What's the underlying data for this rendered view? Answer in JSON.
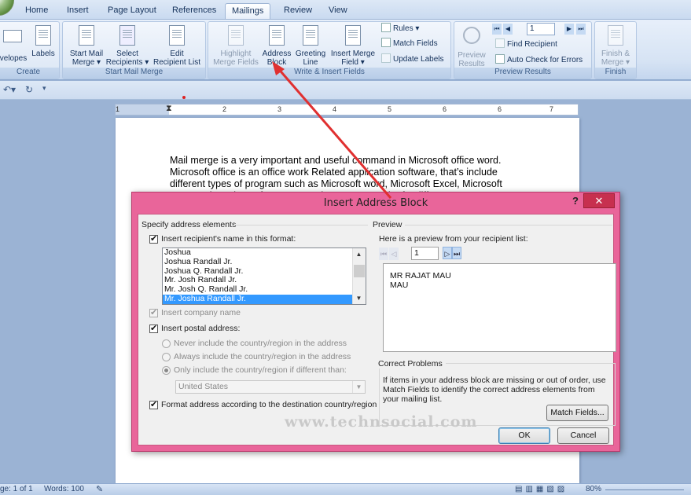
{
  "ribbon_tabs": [
    "Home",
    "Insert",
    "Page Layout",
    "References",
    "Mailings",
    "Review",
    "View"
  ],
  "active_tab": "Mailings",
  "ribbon": {
    "create": {
      "envelopes": "velopes",
      "labels": "Labels",
      "group_label": "Create"
    },
    "start_mail_merge": {
      "start": [
        "Start Mail",
        "Merge ▾"
      ],
      "select": [
        "Select",
        "Recipients ▾"
      ],
      "edit": [
        "Edit",
        "Recipient List"
      ],
      "group_label": "Start Mail Merge"
    },
    "write_insert": {
      "highlight": [
        "Highlight",
        "Merge Fields"
      ],
      "address_block": [
        "Address",
        "Block"
      ],
      "greeting_line": [
        "Greeting",
        "Line"
      ],
      "insert_merge_field": [
        "Insert Merge",
        "Field ▾"
      ],
      "rules": "Rules ▾",
      "match_fields": "Match Fields",
      "update_labels": "Update Labels",
      "group_label": "Write & Insert Fields"
    },
    "preview": {
      "preview_results": [
        "Preview",
        "Results"
      ],
      "record": "1",
      "find_recipient": "Find Recipient",
      "auto_check": "Auto Check for Errors",
      "group_label": "Preview Results"
    },
    "finish": {
      "finish_merge": [
        "Finish &",
        "Merge ▾"
      ],
      "group_label": "Finish"
    }
  },
  "ruler_ticks": [
    "1",
    "1",
    "2",
    "3",
    "4",
    "5",
    "6",
    "7"
  ],
  "document": {
    "paragraph": "Mail merge is a very important and useful command in Microsoft office word. Microsoft office is an office work Related application software, that’s include different types of program such as Microsoft word, Microsoft Excel, Microsoft PowerPoint, Microsoft Access, Exchange, etc. each of a different"
  },
  "status_bar": {
    "page": "ge: 1 of 1",
    "words": "Words: 100",
    "zoom": "80%"
  },
  "dialog": {
    "title": "Insert Address Block",
    "help": "?",
    "close": "✕",
    "specify_label": "Specify address elements",
    "insert_name_label": "Insert recipient's name in this format:",
    "name_formats": [
      "Joshua",
      "Joshua Randall Jr.",
      "Joshua Q. Randall Jr.",
      "Mr. Josh Randall Jr.",
      "Mr. Josh Q. Randall Jr.",
      "Mr. Joshua Randall Jr."
    ],
    "selected_format_index": 5,
    "insert_company_label": "Insert company name",
    "insert_postal_label": "Insert postal address:",
    "radio_never": "Never include the country/region in the address",
    "radio_always": "Always include the country/region in the address",
    "radio_only": "Only include the country/region if different than:",
    "country_value": "United States",
    "format_address_label": "Format address according to the destination country/region",
    "preview_label": "Preview",
    "preview_from_label": "Here is a preview from your recipient list:",
    "record_value": "1",
    "preview_lines": [
      "MR RAJAT MAU",
      "MAU"
    ],
    "correct_problems_label": "Correct Problems",
    "correct_problems_text": "If items in your address block are missing or out of order, use Match Fields to identify the correct address elements from your mailing list.",
    "match_fields_button": "Match Fields...",
    "ok_button": "OK",
    "cancel_button": "Cancel"
  },
  "watermark": "www.technsocial.com",
  "colors": {
    "dialog_frame": "#e9659a",
    "annotation_arrow": "#e03030",
    "selection": "#3399ff"
  }
}
